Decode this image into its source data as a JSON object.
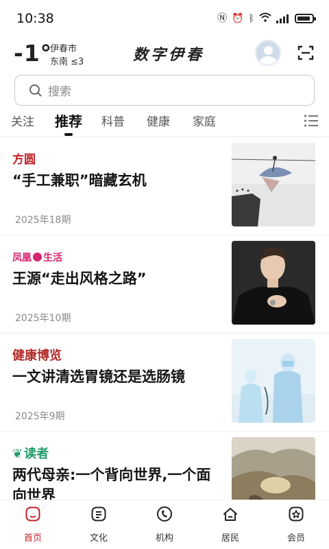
{
  "status_bar": {
    "time": "10:38",
    "battery_fraction": 0.9
  },
  "header": {
    "temperature": "-1°",
    "city": "伊春市",
    "wind": "东南 ≤3",
    "brand_title": "数字伊春"
  },
  "search": {
    "placeholder": "搜索"
  },
  "tabs": [
    {
      "label": "关注",
      "active": false
    },
    {
      "label": "推荐",
      "active": true
    },
    {
      "label": "科普",
      "active": false
    },
    {
      "label": "健康",
      "active": false
    },
    {
      "label": "家庭",
      "active": false
    }
  ],
  "feed": [
    {
      "source": "方圆",
      "source_color": "#c1222b",
      "title": "“手工兼职”暗藏玄机",
      "date": "2025年18期",
      "image": "tightrope-illustration"
    },
    {
      "source": "凤凰",
      "source_suffix": "生活",
      "source_color": "#d6246e",
      "title": "王源“走出风格之路”",
      "date": "2025年10期",
      "image": "portrait-photo"
    },
    {
      "source": "健康博览",
      "source_color": "#b22a2a",
      "title": "一文讲清选胃镜还是选肠镜",
      "date": "2025年9期",
      "image": "medical-staff-illustration"
    },
    {
      "source": "读者",
      "source_color": "#1f9a6a",
      "title": "两代母亲:一个背向世界,一个面向世界",
      "date": "",
      "image": "landscape-photo"
    }
  ],
  "bottom_nav": [
    {
      "label": "首页",
      "icon": "home-icon",
      "active": true
    },
    {
      "label": "文化",
      "icon": "culture-icon",
      "active": false
    },
    {
      "label": "机构",
      "icon": "institution-icon",
      "active": false
    },
    {
      "label": "居民",
      "icon": "resident-icon",
      "active": false
    },
    {
      "label": "会员",
      "icon": "member-icon",
      "active": false
    }
  ],
  "colors": {
    "accent": "#c1222b",
    "text": "#151515",
    "muted": "#888888"
  }
}
